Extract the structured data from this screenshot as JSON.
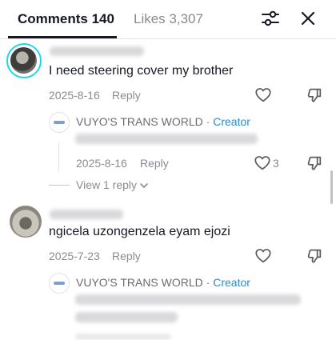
{
  "tabs": {
    "comments_label": "Comments 140",
    "likes_label": "Likes 3,307"
  },
  "icons": {
    "filter": "filter-sliders-icon",
    "close": "close-icon",
    "like": "heart-outline-icon",
    "dislike": "thumbs-down-icon",
    "expand": "chevron-down-icon"
  },
  "colors": {
    "creator_badge": "#2a8cc9",
    "avatar_ring": "#20d5ec",
    "muted_text": "#8a8b91"
  },
  "comments": [
    {
      "text": "I need steering cover my brother",
      "date": "2025-8-16",
      "reply_label": "Reply",
      "creator_reply": {
        "name": "VUYO'S TRANS WORLD",
        "badge": "· Creator",
        "date": "2025-8-16",
        "reply_label": "Reply",
        "like_count": "3"
      },
      "view_replies_label": "View 1 reply"
    },
    {
      "text": "ngicela uzongenzela eyam ejozi",
      "date": "2025-7-23",
      "reply_label": "Reply",
      "creator_reply": {
        "name": "VUYO'S TRANS WORLD",
        "badge": "· Creator"
      }
    }
  ]
}
